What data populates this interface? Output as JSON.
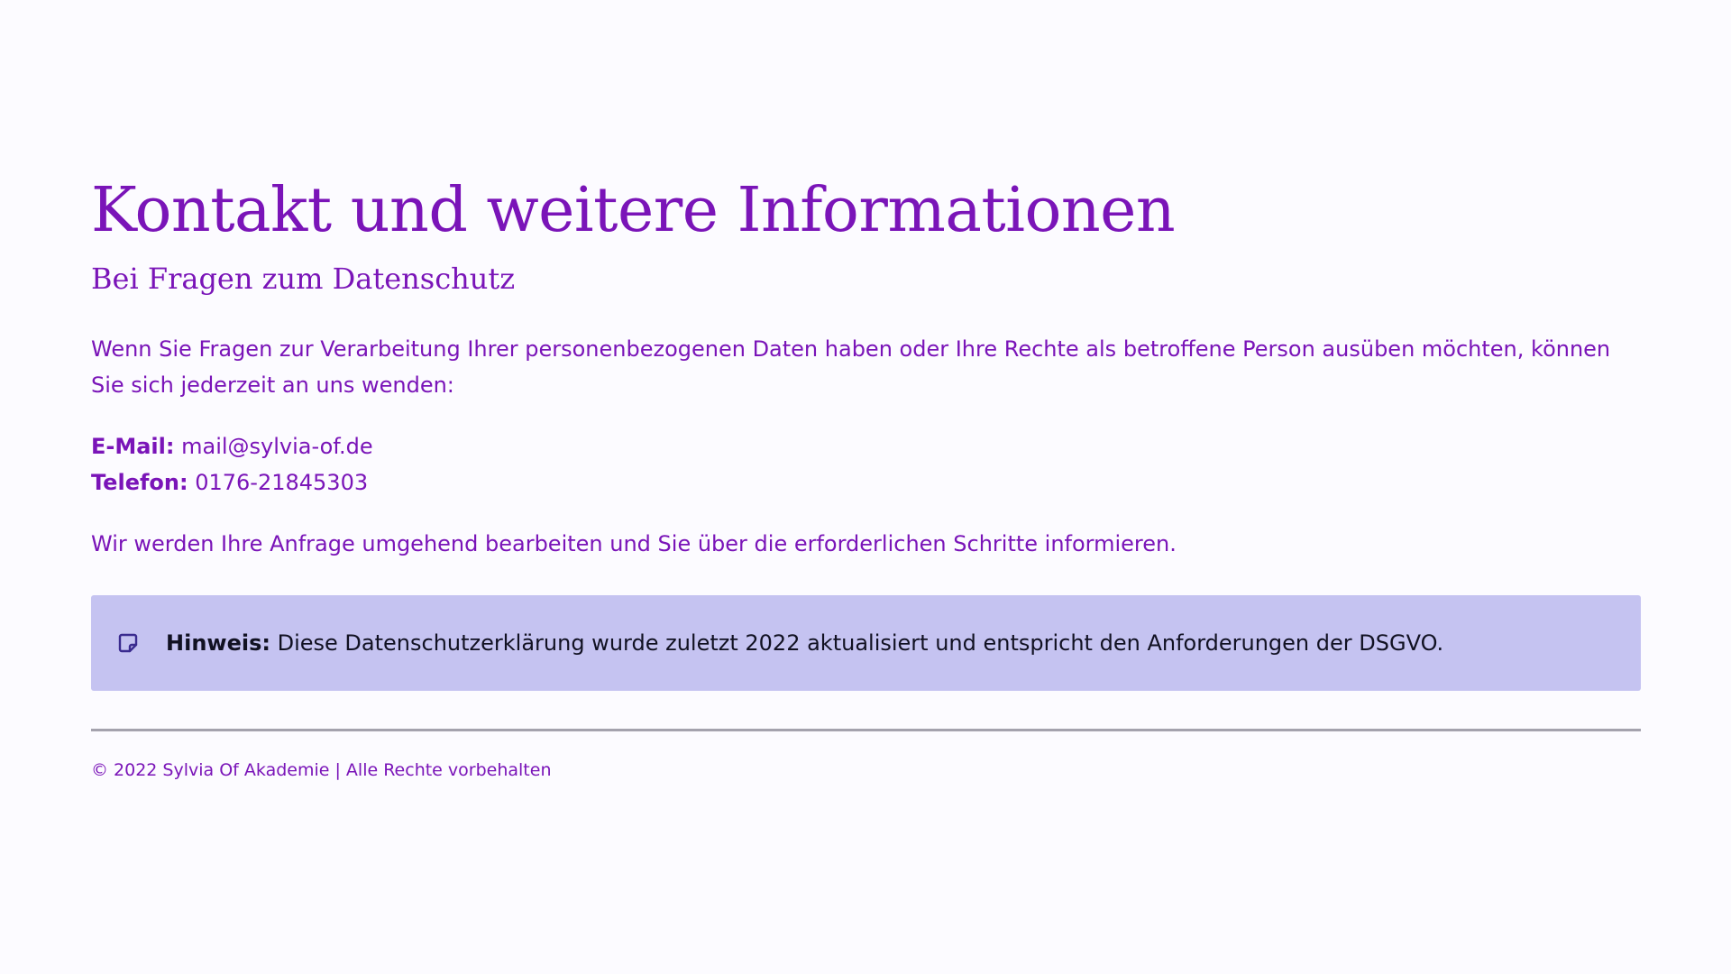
{
  "page": {
    "title": "Kontakt und weitere Informationen",
    "subtitle": "Bei Fragen zum Datenschutz",
    "intro": "Wenn Sie Fragen zur Verarbeitung Ihrer personenbezogenen Daten haben oder Ihre Rechte als betroffene Person ausüben möchten, können Sie sich jederzeit an uns wenden:",
    "contact": {
      "email_label": "E-Mail:",
      "email_value": "mail@sylvia-of.de",
      "phone_label": "Telefon:",
      "phone_value": "0176-21845303"
    },
    "closing": "Wir werden Ihre Anfrage umgehend bearbeiten und Sie über die erforderlichen Schritte informieren."
  },
  "note": {
    "icon": "sticky-note-icon",
    "label": "Hinweis:",
    "text": "Diese Datenschutzerklärung wurde zuletzt 2022 aktualisiert und entspricht den Anforderungen der DSGVO."
  },
  "footer": {
    "text": "© 2022 Sylvia Of Akademie | Alle Rechte vorbehalten"
  },
  "colors": {
    "primary": "#7a14b8",
    "background": "#fcfbff",
    "note_background": "#c5c3f1",
    "note_icon": "#3a2b8f",
    "divider": "#a4a2ad"
  }
}
